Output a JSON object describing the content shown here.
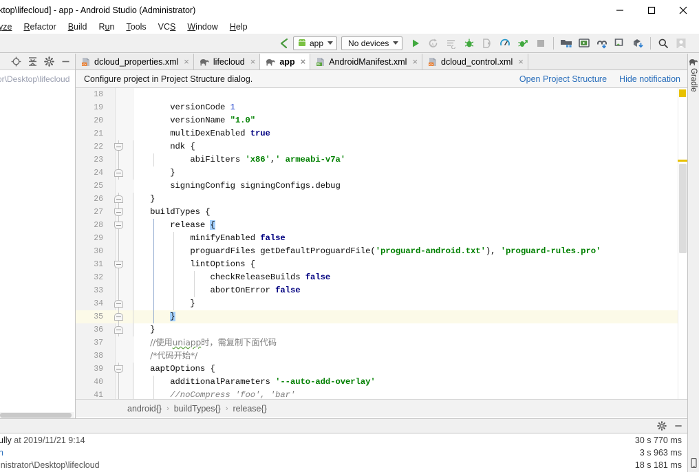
{
  "window": {
    "title": "ktop\\lifecloud] - app - Android Studio (Administrator)",
    "minimize_label": "minimize-icon",
    "maximize_label": "maximize-icon",
    "close_label": "close-icon"
  },
  "menu": {
    "items": [
      {
        "label": "yze",
        "clipped": true
      },
      {
        "label": "Refactor",
        "mnemonic": "R"
      },
      {
        "label": "Build",
        "mnemonic": "B"
      },
      {
        "label": "Run",
        "mnemonic": "u"
      },
      {
        "label": "Tools",
        "mnemonic": "T"
      },
      {
        "label": "VCS",
        "mnemonic": "S"
      },
      {
        "label": "Window",
        "mnemonic": "W"
      },
      {
        "label": "Help",
        "mnemonic": "H"
      }
    ]
  },
  "toolbar": {
    "back_icon": "back-arrow-icon",
    "module_selector": {
      "label": "app",
      "icon": "android-icon"
    },
    "device_selector": {
      "label": "No devices"
    },
    "run_icon": "run-icon",
    "apply_changes_icon": "apply-changes-icon",
    "apply_code_changes_icon": "apply-code-changes-icon",
    "debug_icon": "debug-icon",
    "attach_debugger_icon": "attach-debugger-icon",
    "profiler_icon": "profiler-icon",
    "run_with_coverage_icon": "run-with-coverage-icon",
    "stop_icon": "stop-icon",
    "project_structure_icon": "project-structure-icon",
    "avd_manager_icon": "avd-manager-icon",
    "sync_gradle_icon": "sync-gradle-icon",
    "sdk_manager_icon": "sdk-manager-icon",
    "download_icon": "download-icon",
    "search_icon": "search-icon",
    "account_icon": "account-icon",
    "highlight_color": "#ff1a1a"
  },
  "left_panel": {
    "locate_icon": "locate-target-icon",
    "collapse_icon": "collapse-all-icon",
    "settings_icon": "gear-icon",
    "hide_icon": "minimize-icon",
    "path_text": "or\\Desktop\\lifecloud"
  },
  "editor": {
    "tabs": [
      {
        "label": "dcloud_properties.xml",
        "icon": "xml-file-icon",
        "active": false
      },
      {
        "label": "lifecloud",
        "icon": "gradle-file-icon",
        "active": false
      },
      {
        "label": "app",
        "icon": "gradle-file-icon",
        "active": true
      },
      {
        "label": "AndroidManifest.xml",
        "icon": "manifest-file-icon",
        "active": false
      },
      {
        "label": "dcloud_control.xml",
        "icon": "xml-file-icon",
        "active": false
      }
    ],
    "close_glyph": "×",
    "notification": {
      "message": "Configure project in Project Structure dialog.",
      "actions": [
        "Open Project Structure",
        "Hide notification"
      ]
    },
    "first_line_number": 18,
    "caret_line": 35,
    "lines": [
      {
        "n": 18,
        "indent": 0,
        "code": "",
        "fold": null
      },
      {
        "n": 19,
        "indent": 0,
        "code": "        versionCode <span class=\"tok-num\">1</span>",
        "fold": null
      },
      {
        "n": 20,
        "indent": 0,
        "code": "        versionName <span class=\"tok-str\">\"1.0\"</span>",
        "fold": null
      },
      {
        "n": 21,
        "indent": 0,
        "code": "        multiDexEnabled <span class=\"tok-kw\">true</span>",
        "fold": null
      },
      {
        "n": 22,
        "indent": 0,
        "code": "        ndk {",
        "fold": "open"
      },
      {
        "n": 23,
        "indent": 0,
        "code": "            abiFilters <span class=\"tok-str\">'x86'</span>,<span class=\"tok-str\">' armeabi-v7a'</span>",
        "fold": null
      },
      {
        "n": 24,
        "indent": 0,
        "code": "        }",
        "fold": "close"
      },
      {
        "n": 25,
        "indent": 0,
        "code": "        signingConfig signingConfigs.debug",
        "fold": null
      },
      {
        "n": 26,
        "indent": 0,
        "code": "    }",
        "fold": "close"
      },
      {
        "n": 27,
        "indent": 0,
        "code": "    buildTypes {",
        "fold": "open"
      },
      {
        "n": 28,
        "indent": 0,
        "code": "        release <span class=\"tok-sel\">{</span>",
        "fold": "open"
      },
      {
        "n": 29,
        "indent": 0,
        "code": "            minifyEnabled <span class=\"tok-kw\">false</span>",
        "fold": null
      },
      {
        "n": 30,
        "indent": 0,
        "code": "            proguardFiles getDefaultProguardFile(<span class=\"tok-str\">'proguard-android.txt'</span>), <span class=\"tok-str\">'proguard-rules.pro'</span>",
        "fold": null
      },
      {
        "n": 31,
        "indent": 0,
        "code": "            lintOptions {",
        "fold": "open"
      },
      {
        "n": 32,
        "indent": 0,
        "code": "                checkReleaseBuilds <span class=\"tok-kw\">false</span>",
        "fold": null
      },
      {
        "n": 33,
        "indent": 0,
        "code": "                abortOnError <span class=\"tok-kw\">false</span>",
        "fold": null
      },
      {
        "n": 34,
        "indent": 0,
        "code": "            }",
        "fold": "close"
      },
      {
        "n": 35,
        "indent": 0,
        "code": "        <span class=\"tok-sel\">}</span>",
        "fold": "close"
      },
      {
        "n": 36,
        "indent": 0,
        "code": "    }",
        "fold": "close"
      },
      {
        "n": 37,
        "indent": 0,
        "code": "    <span class=\"tok-cmt-cn\">//使用<span class=\"wavy\">uniapp</span>时，需复制下面代码</span>",
        "fold": null
      },
      {
        "n": 38,
        "indent": 0,
        "code": "    <span class=\"tok-cmt-cn\">/*代码开始*/</span>",
        "fold": null
      },
      {
        "n": 39,
        "indent": 0,
        "code": "    aaptOptions {",
        "fold": "open"
      },
      {
        "n": 40,
        "indent": 0,
        "code": "        additionalParameters <span class=\"tok-str\">'--auto-add-overlay'</span>",
        "fold": null
      },
      {
        "n": 41,
        "indent": 0,
        "code": "        <span class=\"tok-cmt\">//noCompress 'foo', 'bar'</span>",
        "fold": null
      }
    ],
    "breadcrumb": [
      "android{}",
      "buildTypes{}",
      "release{}"
    ],
    "breadcrumb_separator": "›"
  },
  "right_sidebar": {
    "gradle_tab": "Gradle",
    "gradle_icon": "gradle-elephant-icon",
    "device_file_explorer_icon": "device-file-explorer-icon"
  },
  "build_panel": {
    "settings_icon": "gear-icon",
    "hide_icon": "minimize-icon",
    "rows": [
      {
        "left_plain": "ully",
        "left_dim": " at 2019/11/21 9:14",
        "time": "30 s 770 ms"
      },
      {
        "left_link": "n",
        "left_plain": "",
        "left_dim": "",
        "time": "3 s 963 ms"
      },
      {
        "left_plain": "",
        "left_dim": "inistrator\\Desktop\\lifecloud",
        "time": "18 s 181 ms"
      }
    ]
  }
}
